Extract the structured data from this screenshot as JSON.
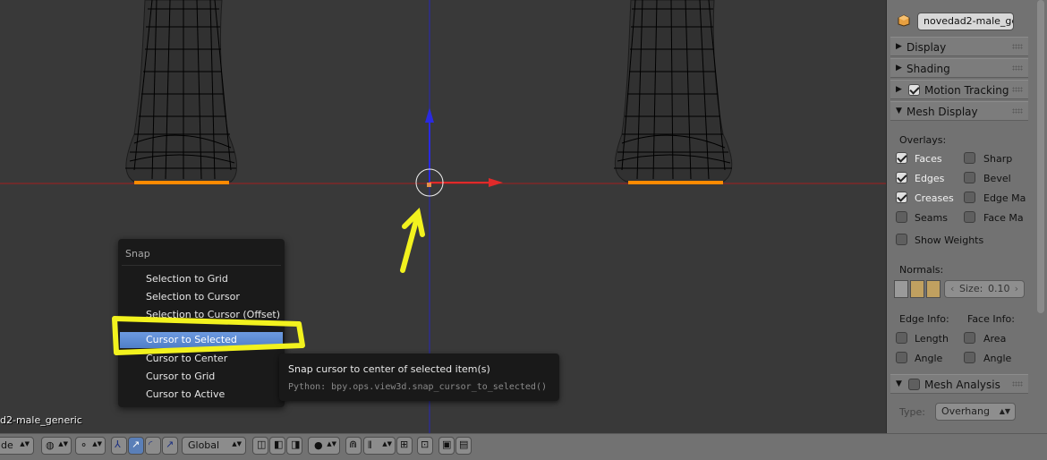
{
  "viewport": {
    "object_name_partial": "d2-male_generic"
  },
  "snap_menu": {
    "title": "Snap",
    "items": [
      {
        "label": "Selection to Grid",
        "active": false
      },
      {
        "label": "Selection to Cursor",
        "active": false
      },
      {
        "label": "Selection to Cursor (Offset)",
        "active": false
      },
      {
        "label": "Cursor to Selected",
        "active": true
      },
      {
        "label": "Cursor to Center",
        "active": false
      },
      {
        "label": "Cursor to Grid",
        "active": false
      },
      {
        "label": "Cursor to Active",
        "active": false
      }
    ]
  },
  "tooltip": {
    "description": "Snap cursor to center of selected item(s)",
    "python": "Python: bpy.ops.view3d.snap_cursor_to_selected()"
  },
  "properties_panel": {
    "object_name": "novedad2-male_ge...",
    "sections": {
      "display": "Display",
      "shading": "Shading",
      "motion_tracking": "Motion Tracking",
      "mesh_display": "Mesh Display",
      "mesh_analysis": "Mesh Analysis"
    },
    "overlays_label": "Overlays:",
    "overlays": {
      "faces": {
        "label": "Faces",
        "checked": true
      },
      "sharp": {
        "label": "Sharp",
        "checked": false
      },
      "edges": {
        "label": "Edges",
        "checked": true
      },
      "bevel": {
        "label": "Bevel",
        "checked": false
      },
      "creases": {
        "label": "Creases",
        "checked": true
      },
      "edge_marks": {
        "label": "Edge Ma",
        "checked": false
      },
      "seams": {
        "label": "Seams",
        "checked": false
      },
      "face_marks": {
        "label": "Face Ma",
        "checked": false
      },
      "show_weights": {
        "label": "Show Weights",
        "checked": false
      }
    },
    "normals_label": "Normals:",
    "normals_size_label": "Size:",
    "normals_size_value": "0.10",
    "edge_info_label": "Edge Info:",
    "face_info_label": "Face Info:",
    "edge_info": {
      "length": "Length",
      "angle": "Angle"
    },
    "face_info": {
      "area": "Area",
      "angle": "Angle"
    },
    "type_label": "Type:",
    "type_value": "Overhang"
  },
  "header": {
    "mode_partial": "de",
    "orientation": "Global"
  },
  "colors": {
    "annotation_yellow": "#f2f21e",
    "menu_highlight": "#5a86d0",
    "x_axis": "#d02020",
    "z_axis": "#2020d0",
    "selected_vertex": "#ff8a00"
  }
}
